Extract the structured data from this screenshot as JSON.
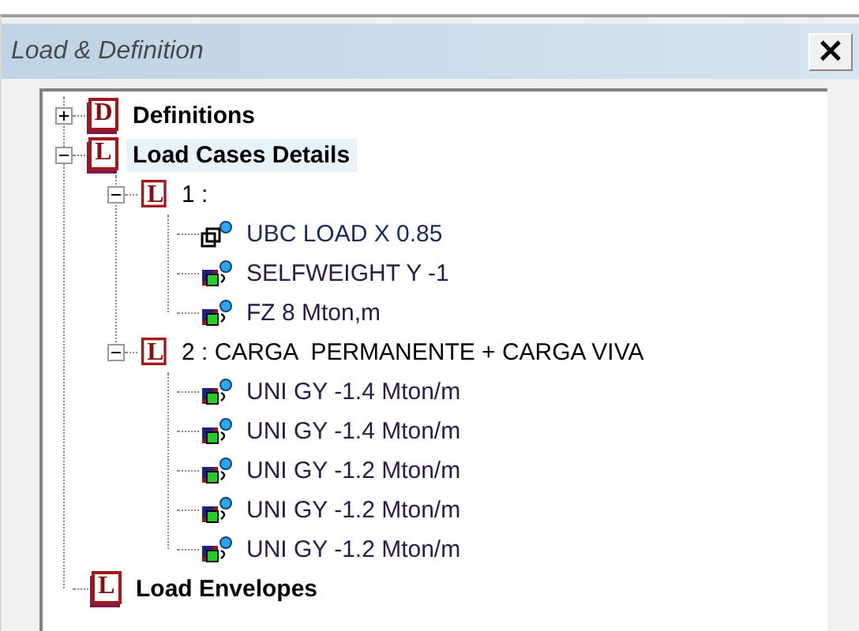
{
  "window": {
    "title": "Load & Definition",
    "close": "×"
  },
  "tree": [
    {
      "kind": "book",
      "icon_letter": "D",
      "label": "Definitions",
      "expanded": false,
      "selected": false
    },
    {
      "kind": "book",
      "icon_letter": "L",
      "label": "Load Cases Details",
      "expanded": true,
      "selected": true,
      "children": [
        {
          "kind": "case",
          "icon_letter": "L",
          "label": "1 :",
          "expanded": true,
          "selected": false,
          "children": [
            {
              "kind": "seismic",
              "label": "UBC LOAD X 0.85",
              "selected": false
            },
            {
              "kind": "load",
              "label": "SELFWEIGHT Y -1",
              "selected": false
            },
            {
              "kind": "load",
              "label": "FZ 8 Mton,m",
              "selected": false
            }
          ]
        },
        {
          "kind": "case",
          "icon_letter": "L",
          "label": "2 : CARGA  PERMANENTE + CARGA VIVA",
          "expanded": true,
          "selected": false,
          "children": [
            {
              "kind": "load",
              "label": "UNI GY -1.4 Mton/m",
              "selected": false
            },
            {
              "kind": "load",
              "label": "UNI GY -1.4 Mton/m",
              "selected": false
            },
            {
              "kind": "load",
              "label": "UNI GY -1.2 Mton/m",
              "selected": false
            },
            {
              "kind": "load",
              "label": "UNI GY -1.2 Mton/m",
              "selected": false
            },
            {
              "kind": "load",
              "label": "UNI GY -1.2 Mton/m",
              "selected": false
            }
          ]
        }
      ]
    },
    {
      "kind": "book",
      "icon_letter": "L",
      "label": "Load Envelopes",
      "selected": false
    }
  ]
}
